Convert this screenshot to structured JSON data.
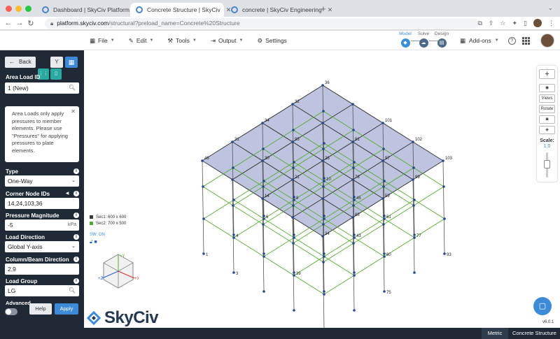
{
  "browser": {
    "tabs": [
      {
        "title": "Dashboard | SkyCiv Platform",
        "active": false
      },
      {
        "title": "Concrete Structure | SkyCiv",
        "active": true
      },
      {
        "title": "concrete | SkyCiv Engineering",
        "active": false
      }
    ],
    "url_host": "platform.skyciv.com",
    "url_path": "/structural?preload_name=Concrete%20Structure"
  },
  "menu": {
    "file": "File",
    "edit": "Edit",
    "tools": "Tools",
    "output": "Output",
    "settings": "Settings",
    "addons": "Add-ons"
  },
  "stages": {
    "model": "Model",
    "solve": "Solve",
    "design": "Design"
  },
  "panel": {
    "back": "Back",
    "area_load_id_label": "Area Load ID",
    "area_load_id_value": "1 (New)",
    "info_text": "Area Loads only apply pressures to member elements. Please use \"Pressures\" for applying pressures to plate elements.",
    "type_label": "Type",
    "type_value": "One-Way",
    "corner_nodes_label": "Corner Node IDs",
    "corner_nodes_value": "14,24,103,36",
    "pressure_label": "Pressure Magnitude",
    "pressure_value": "-5",
    "pressure_unit": "kPa",
    "load_dir_label": "Load Direction",
    "load_dir_value": "Global Y-axis",
    "col_beam_label": "Column/Beam Direction",
    "col_beam_value": "2,9",
    "load_group_label": "Load Group",
    "load_group_value": "LG",
    "advanced_label": "Advanced",
    "help": "Help",
    "apply": "Apply"
  },
  "toolbar": {
    "views": "Views",
    "rotate": "Rotate",
    "scale_label": "Scale:",
    "scale_value": "1.0"
  },
  "legend": {
    "sec1": "Sec1: 600 x 600",
    "sec2": "Sec2: 700 x 500",
    "sw": "SW: ON"
  },
  "colors": {
    "sec1": "#3a3a3a",
    "sec2": "#55aa33",
    "node": "#27488f",
    "plate": "#a3a9d2",
    "accent": "#3d8bd8",
    "panel": "#1f2a36"
  },
  "logo": "SkyCiv",
  "version": "v6.0.1",
  "bottom": {
    "metric": "Metric",
    "project": "Concrete Structure"
  },
  "model_labels": {
    "top_nodes": [
      {
        "id": "36",
        "i": 4,
        "j": 0
      },
      {
        "id": "101",
        "i": 4,
        "j": 2
      },
      {
        "id": "102",
        "i": 4,
        "j": 3
      },
      {
        "id": "103",
        "i": 4,
        "j": 4
      },
      {
        "id": "34",
        "i": 2,
        "j": 0
      },
      {
        "id": "30",
        "i": 1,
        "j": 1
      },
      {
        "id": "31",
        "i": 1,
        "j": 0
      },
      {
        "id": "46",
        "i": 0,
        "j": 0
      },
      {
        "id": "26",
        "i": 2,
        "j": 2
      },
      {
        "id": "21",
        "i": 1,
        "j": 2
      },
      {
        "id": "14",
        "i": 0,
        "j": 2
      },
      {
        "id": "81",
        "i": 3,
        "j": 2
      },
      {
        "id": "97",
        "i": 3,
        "j": 3
      },
      {
        "id": "99",
        "i": 3,
        "j": 4
      },
      {
        "id": "78",
        "i": 2,
        "j": 3
      },
      {
        "id": "95",
        "i": 2,
        "j": 1
      },
      {
        "id": "32",
        "i": 3,
        "j": 0
      },
      {
        "id": "24",
        "i": 0,
        "j": 4
      },
      {
        "id": "59",
        "i": 2,
        "j": 4
      },
      {
        "id": "83",
        "i": 1,
        "j": 4
      }
    ],
    "base_nodes": [
      {
        "id": "1",
        "i": 0,
        "j": 0
      },
      {
        "id": "4",
        "i": 1,
        "j": 0
      },
      {
        "id": "6",
        "i": 2,
        "j": 0
      },
      {
        "id": "8",
        "i": 3,
        "j": 0
      },
      {
        "id": "10",
        "i": 4,
        "j": 0
      },
      {
        "id": "45",
        "i": 4,
        "j": 1
      },
      {
        "id": "61",
        "i": 4,
        "j": 2
      },
      {
        "id": "77",
        "i": 4,
        "j": 3
      },
      {
        "id": "93",
        "i": 4,
        "j": 4
      },
      {
        "id": "3",
        "i": 0,
        "j": 1
      },
      {
        "id": "39",
        "i": 1,
        "j": 2
      },
      {
        "id": "43",
        "i": 3,
        "j": 2
      },
      {
        "id": "60",
        "i": 3,
        "j": 3
      },
      {
        "id": "75",
        "i": 2,
        "j": 4
      }
    ]
  }
}
